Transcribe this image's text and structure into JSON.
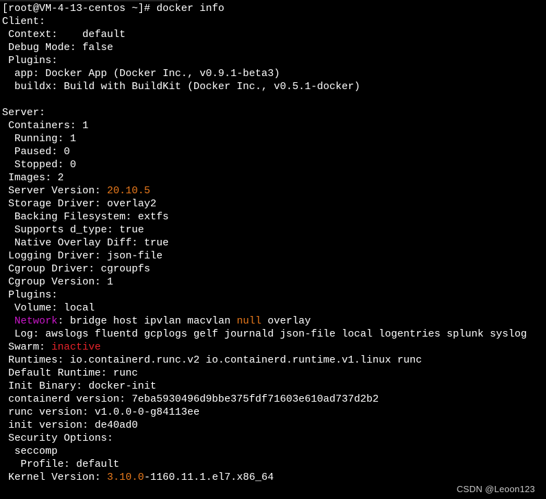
{
  "terminal": {
    "prompt": "[root@VM-4-13-centos ~]# ",
    "command": "docker info",
    "colors": {
      "text": "#ffffff",
      "orange": "#e8791c",
      "red": "#e8232a",
      "magenta": "#c817c8",
      "background": "#000000"
    },
    "lines": [
      [
        {
          "t": "[root@VM-4-13-centos ~]# docker info"
        }
      ],
      [
        {
          "t": "Client:"
        }
      ],
      [
        {
          "t": " Context:    default"
        }
      ],
      [
        {
          "t": " Debug Mode: false"
        }
      ],
      [
        {
          "t": " Plugins:"
        }
      ],
      [
        {
          "t": "  app: Docker App (Docker Inc., v0.9.1-beta3)"
        }
      ],
      [
        {
          "t": "  buildx: Build with BuildKit (Docker Inc., v0.5.1-docker)"
        }
      ],
      [
        {
          "t": ""
        }
      ],
      [
        {
          "t": "Server:"
        }
      ],
      [
        {
          "t": " Containers: 1"
        }
      ],
      [
        {
          "t": "  Running: 1"
        }
      ],
      [
        {
          "t": "  Paused: 0"
        }
      ],
      [
        {
          "t": "  Stopped: 0"
        }
      ],
      [
        {
          "t": " Images: 2"
        }
      ],
      [
        {
          "t": " Server Version: "
        },
        {
          "t": "20.10.5",
          "c": "orange"
        }
      ],
      [
        {
          "t": " Storage Driver: overlay2"
        }
      ],
      [
        {
          "t": "  Backing Filesystem: extfs"
        }
      ],
      [
        {
          "t": "  Supports d_type: true"
        }
      ],
      [
        {
          "t": "  Native Overlay Diff: true"
        }
      ],
      [
        {
          "t": " Logging Driver: json-file"
        }
      ],
      [
        {
          "t": " Cgroup Driver: cgroupfs"
        }
      ],
      [
        {
          "t": " Cgroup Version: 1"
        }
      ],
      [
        {
          "t": " Plugins:"
        }
      ],
      [
        {
          "t": "  Volume: local"
        }
      ],
      [
        {
          "t": "  "
        },
        {
          "t": "Network",
          "c": "magenta"
        },
        {
          "t": ": bridge host ipvlan macvlan "
        },
        {
          "t": "null",
          "c": "orange"
        },
        {
          "t": " overlay"
        }
      ],
      [
        {
          "t": "  Log: awslogs fluentd gcplogs gelf journald json-file local logentries splunk syslog"
        }
      ],
      [
        {
          "t": " Swarm: "
        },
        {
          "t": "inactive",
          "c": "red"
        }
      ],
      [
        {
          "t": " Runtimes: io.containerd.runc.v2 io.containerd.runtime.v1.linux runc"
        }
      ],
      [
        {
          "t": " Default Runtime: runc"
        }
      ],
      [
        {
          "t": " Init Binary: docker-init"
        }
      ],
      [
        {
          "t": " containerd version: 7eba5930496d9bbe375fdf71603e610ad737d2b2"
        }
      ],
      [
        {
          "t": " runc version: v1.0.0-0-g84113ee"
        }
      ],
      [
        {
          "t": " init version: de40ad0"
        }
      ],
      [
        {
          "t": " Security Options:"
        }
      ],
      [
        {
          "t": "  seccomp"
        }
      ],
      [
        {
          "t": "   Profile: default"
        }
      ],
      [
        {
          "t": " Kernel Version: "
        },
        {
          "t": "3.10.0",
          "c": "orange"
        },
        {
          "t": "-1160.11.1.el7.x86_64"
        }
      ]
    ]
  },
  "watermark": "CSDN @Leoon123"
}
